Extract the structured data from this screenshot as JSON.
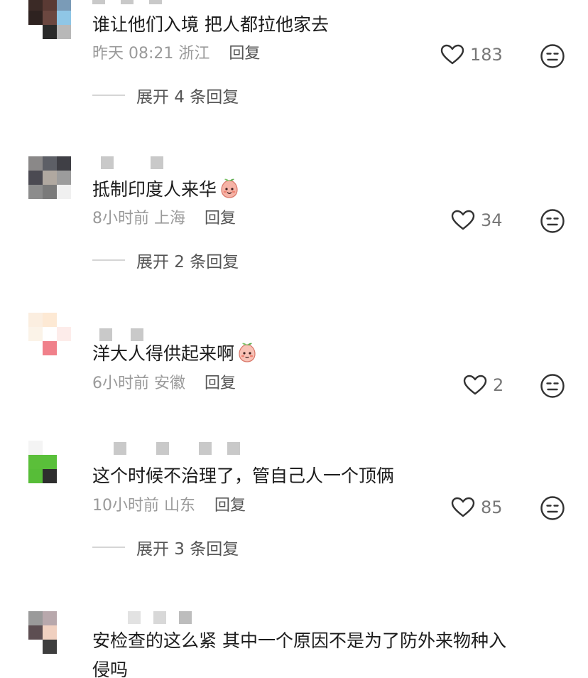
{
  "comments": [
    {
      "text": "谁让他们入境 把人都拉他家去",
      "time": "昨天 08:21",
      "location": "浙江",
      "reply_label": "回复",
      "likes": "183",
      "expand_label": "展开 4 条回复"
    },
    {
      "text": "抵制印度人来华",
      "time": "8小时前",
      "location": "上海",
      "reply_label": "回复",
      "likes": "34",
      "expand_label": "展开 2 条回复",
      "emoji": "peach-face-emoji"
    },
    {
      "text": "洋大人得供起来啊",
      "time": "6小时前",
      "location": "安徽",
      "reply_label": "回复",
      "likes": "2",
      "emoji": "peach-face-emoji"
    },
    {
      "text": "这个时候不治理了，管自己人一个顶俩",
      "time": "10小时前",
      "location": "山东",
      "reply_label": "回复",
      "likes": "85",
      "expand_label": "展开 3 条回复"
    },
    {
      "text": "安检查的这么紧 其中一个原因不是为了防外来物种入",
      "text2": "侵吗"
    }
  ],
  "icons": {
    "like": "heart-outline-icon",
    "reaction": "neutral-face-icon"
  },
  "colors": {
    "text": "#1c1c1c",
    "meta": "#9a9a9a",
    "reply": "#555555"
  }
}
